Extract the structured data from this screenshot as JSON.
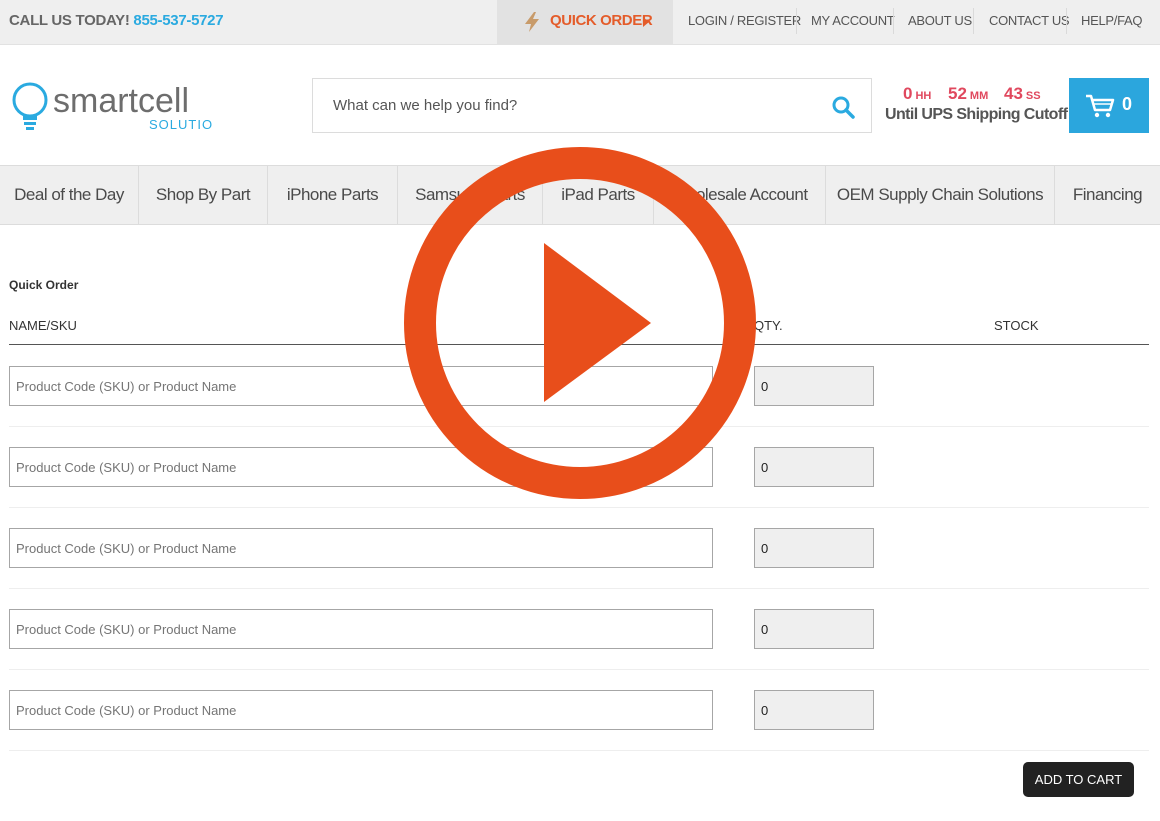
{
  "topbar": {
    "call_label": "CALL US TODAY!",
    "phone": "855-537-5727",
    "quick_order": "QUICK ORDER",
    "links": [
      "LOGIN / REGISTER",
      "MY ACCOUNT",
      "ABOUT US",
      "CONTACT US",
      "HELP/FAQ"
    ]
  },
  "logo": {
    "name": "smartcell",
    "tagline": "SOLUTIONS"
  },
  "search": {
    "placeholder": "What can we help you find?"
  },
  "timer": {
    "hh": "0",
    "hh_unit": "HH",
    "mm": "52",
    "mm_unit": "MM",
    "ss": "43",
    "ss_unit": "SS",
    "caption": "Until UPS Shipping Cutoff"
  },
  "cart": {
    "count": "0"
  },
  "nav": [
    "Deal of the Day",
    "Shop By Part",
    "iPhone Parts",
    "Samsung Parts",
    "iPad Parts",
    "Wholesale Account",
    "OEM Supply Chain Solutions",
    "Financing"
  ],
  "quick_order_form": {
    "title": "Quick Order",
    "headers": {
      "name": "NAME/SKU",
      "qty": "QTY.",
      "stock": "STOCK"
    },
    "rows": [
      {
        "placeholder": "Product Code (SKU) or Product Name",
        "qty": "0"
      },
      {
        "placeholder": "Product Code (SKU) or Product Name",
        "qty": "0"
      },
      {
        "placeholder": "Product Code (SKU) or Product Name",
        "qty": "0"
      },
      {
        "placeholder": "Product Code (SKU) or Product Name",
        "qty": "0"
      },
      {
        "placeholder": "Product Code (SKU) or Product Name",
        "qty": "0"
      }
    ],
    "add_to_cart": "ADD TO CART"
  },
  "colors": {
    "accent_blue": "#2ba6dd",
    "accent_orange": "#e45c2a",
    "timer_red": "#e0485e",
    "play_orange": "#e84e1b"
  }
}
